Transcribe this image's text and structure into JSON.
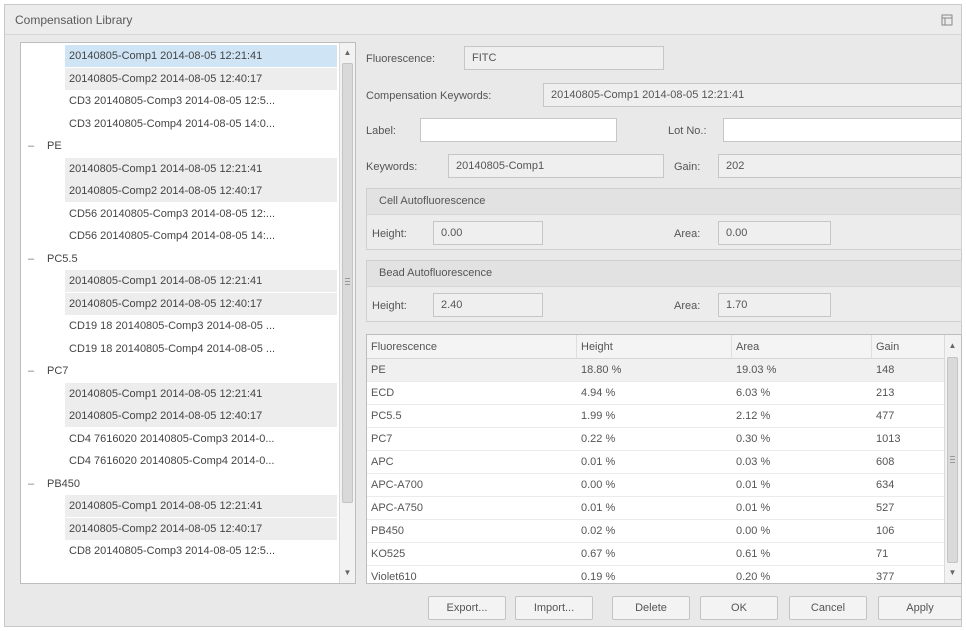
{
  "window": {
    "title": "Compensation Library"
  },
  "tree": {
    "items": [
      {
        "type": "child",
        "label": "20140805-Comp1 2014-08-05 12:21:41",
        "selected": true
      },
      {
        "type": "child",
        "label": "20140805-Comp2 2014-08-05 12:40:17"
      },
      {
        "type": "child",
        "label": "CD3 20140805-Comp3 2014-08-05 12:5..."
      },
      {
        "type": "child",
        "label": "CD3 20140805-Comp4 2014-08-05 14:0..."
      },
      {
        "type": "group",
        "label": "PE",
        "expander": "–"
      },
      {
        "type": "child",
        "label": "20140805-Comp1 2014-08-05 12:21:41"
      },
      {
        "type": "child",
        "label": "20140805-Comp2 2014-08-05 12:40:17"
      },
      {
        "type": "child",
        "label": "CD56 20140805-Comp3 2014-08-05 12:..."
      },
      {
        "type": "child",
        "label": "CD56 20140805-Comp4 2014-08-05 14:..."
      },
      {
        "type": "group",
        "label": "PC5.5",
        "expander": "–"
      },
      {
        "type": "child",
        "label": "20140805-Comp1 2014-08-05 12:21:41"
      },
      {
        "type": "child",
        "label": "20140805-Comp2 2014-08-05 12:40:17"
      },
      {
        "type": "child",
        "label": "CD19 18 20140805-Comp3 2014-08-05 ..."
      },
      {
        "type": "child",
        "label": "CD19 18 20140805-Comp4 2014-08-05 ..."
      },
      {
        "type": "group",
        "label": "PC7",
        "expander": "–"
      },
      {
        "type": "child",
        "label": "20140805-Comp1 2014-08-05 12:21:41"
      },
      {
        "type": "child",
        "label": "20140805-Comp2 2014-08-05 12:40:17"
      },
      {
        "type": "child",
        "label": "CD4 7616020 20140805-Comp3 2014-0..."
      },
      {
        "type": "child",
        "label": "CD4 7616020 20140805-Comp4 2014-0..."
      },
      {
        "type": "group",
        "label": "PB450",
        "expander": "–"
      },
      {
        "type": "child",
        "label": "20140805-Comp1 2014-08-05 12:21:41"
      },
      {
        "type": "child",
        "label": "20140805-Comp2 2014-08-05 12:40:17"
      },
      {
        "type": "child",
        "label": "CD8 20140805-Comp3 2014-08-05 12:5..."
      }
    ]
  },
  "form": {
    "fluorescence_label": "Fluorescence:",
    "fluorescence_value": "FITC",
    "comp_keywords_label": "Compensation Keywords:",
    "comp_keywords_value": "20140805-Comp1 2014-08-05 12:21:41",
    "label_label": "Label:",
    "label_value": "",
    "lot_label": "Lot No.:",
    "lot_value": "",
    "keywords_label": "Keywords:",
    "keywords_value": "20140805-Comp1",
    "gain_label": "Gain:",
    "gain_value": "202"
  },
  "cell_auto": {
    "title": "Cell Autofluorescence",
    "height_label": "Height:",
    "height_value": "0.00",
    "area_label": "Area:",
    "area_value": "0.00"
  },
  "bead_auto": {
    "title": "Bead Autofluorescence",
    "height_label": "Height:",
    "height_value": "2.40",
    "area_label": "Area:",
    "area_value": "1.70"
  },
  "table": {
    "headers": [
      "Fluorescence",
      "Height",
      "Area",
      "Gain"
    ],
    "rows": [
      [
        "PE",
        "18.80 %",
        "19.03 %",
        "148"
      ],
      [
        "ECD",
        "4.94 %",
        "6.03 %",
        "213"
      ],
      [
        "PC5.5",
        "1.99 %",
        "2.12 %",
        "477"
      ],
      [
        "PC7",
        "0.22 %",
        "0.30 %",
        "1013"
      ],
      [
        "APC",
        "0.01 %",
        "0.03 %",
        "608"
      ],
      [
        "APC-A700",
        "0.00 %",
        "0.01 %",
        "634"
      ],
      [
        "APC-A750",
        "0.01 %",
        "0.01 %",
        "527"
      ],
      [
        "PB450",
        "0.02 %",
        "0.00 %",
        "106"
      ],
      [
        "KO525",
        "0.67 %",
        "0.61 %",
        "71"
      ],
      [
        "Violet610",
        "0.19 %",
        "0.20 %",
        "377"
      ]
    ]
  },
  "buttons": {
    "export": "Export...",
    "import": "Import...",
    "delete": "Delete",
    "ok": "OK",
    "cancel": "Cancel",
    "apply": "Apply"
  },
  "colors": {
    "selected_row": "#cfe5f6",
    "window_bg": "#e9e9e9"
  }
}
